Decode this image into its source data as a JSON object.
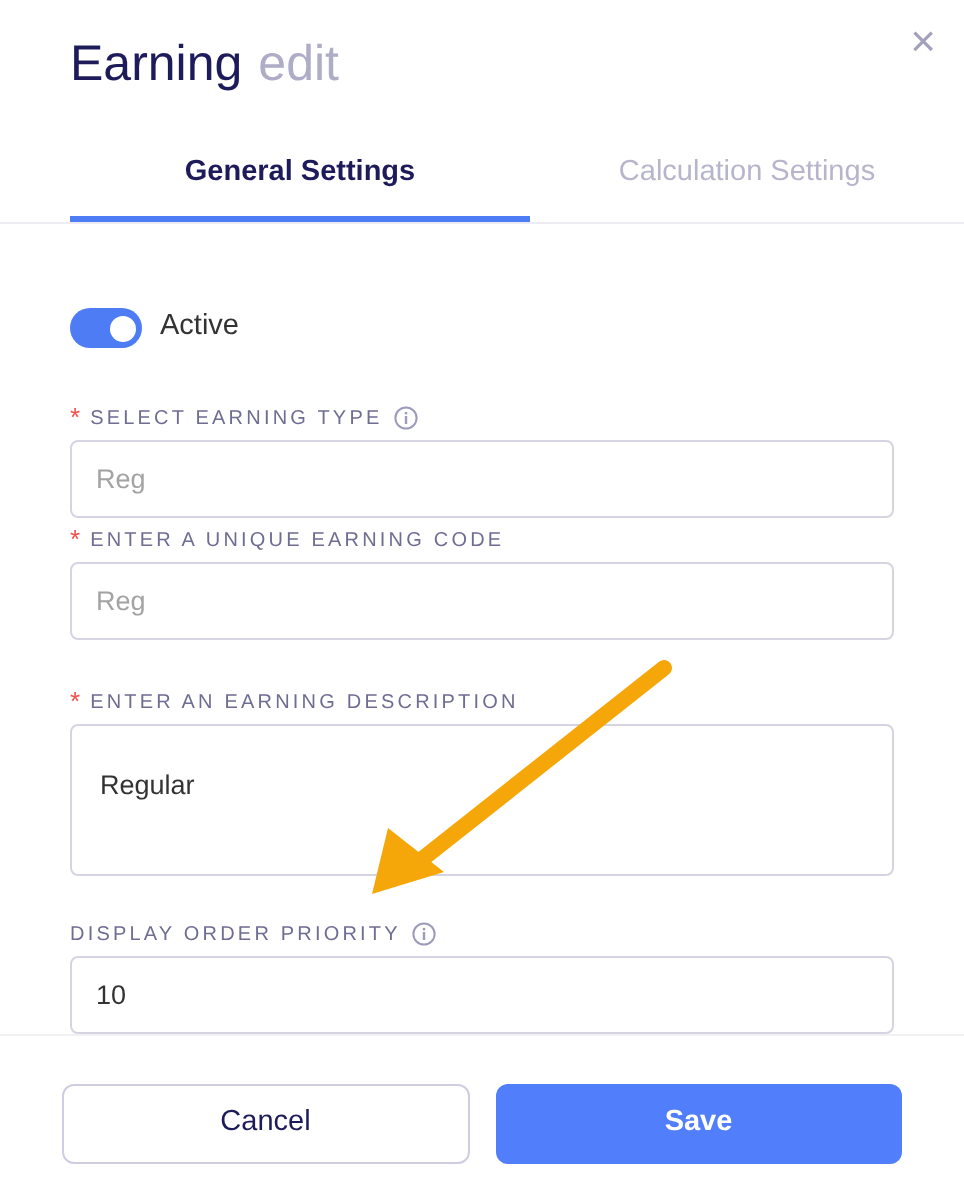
{
  "dialog": {
    "title": "Earning",
    "subtitle": "edit",
    "close": "×"
  },
  "tabs": [
    {
      "label": "General Settings",
      "selected": true
    },
    {
      "label": "Calculation Settings",
      "selected": false
    }
  ],
  "active_toggle": {
    "label": "Active",
    "on": true
  },
  "fields": [
    {
      "kind": "input",
      "required_mark": "*",
      "label": "SELECT EARNING TYPE",
      "info": true,
      "placeholder": "Reg"
    },
    {
      "kind": "input",
      "required_mark": "*",
      "label": "ENTER A UNIQUE EARNING CODE",
      "info": false,
      "placeholder": "Reg"
    },
    {
      "kind": "textarea",
      "required_mark": "*",
      "label": "ENTER AN EARNING DESCRIPTION",
      "info": false,
      "value": "Regular"
    },
    {
      "kind": "input",
      "label": "DISPLAY ORDER PRIORITY",
      "info": true,
      "value": "10"
    }
  ],
  "buttons": [
    {
      "label": "Cancel",
      "kind": "secondary"
    },
    {
      "label": "Save",
      "kind": "primary"
    }
  ]
}
